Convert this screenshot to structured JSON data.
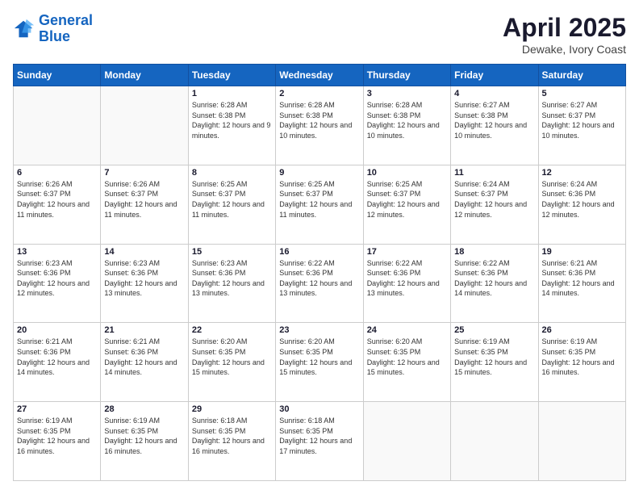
{
  "logo": {
    "line1": "General",
    "line2": "Blue"
  },
  "title": "April 2025",
  "subtitle": "Dewake, Ivory Coast",
  "days_header": [
    "Sunday",
    "Monday",
    "Tuesday",
    "Wednesday",
    "Thursday",
    "Friday",
    "Saturday"
  ],
  "weeks": [
    [
      {
        "day": "",
        "info": ""
      },
      {
        "day": "",
        "info": ""
      },
      {
        "day": "1",
        "info": "Sunrise: 6:28 AM\nSunset: 6:38 PM\nDaylight: 12 hours and 9 minutes."
      },
      {
        "day": "2",
        "info": "Sunrise: 6:28 AM\nSunset: 6:38 PM\nDaylight: 12 hours and 10 minutes."
      },
      {
        "day": "3",
        "info": "Sunrise: 6:28 AM\nSunset: 6:38 PM\nDaylight: 12 hours and 10 minutes."
      },
      {
        "day": "4",
        "info": "Sunrise: 6:27 AM\nSunset: 6:38 PM\nDaylight: 12 hours and 10 minutes."
      },
      {
        "day": "5",
        "info": "Sunrise: 6:27 AM\nSunset: 6:37 PM\nDaylight: 12 hours and 10 minutes."
      }
    ],
    [
      {
        "day": "6",
        "info": "Sunrise: 6:26 AM\nSunset: 6:37 PM\nDaylight: 12 hours and 11 minutes."
      },
      {
        "day": "7",
        "info": "Sunrise: 6:26 AM\nSunset: 6:37 PM\nDaylight: 12 hours and 11 minutes."
      },
      {
        "day": "8",
        "info": "Sunrise: 6:25 AM\nSunset: 6:37 PM\nDaylight: 12 hours and 11 minutes."
      },
      {
        "day": "9",
        "info": "Sunrise: 6:25 AM\nSunset: 6:37 PM\nDaylight: 12 hours and 11 minutes."
      },
      {
        "day": "10",
        "info": "Sunrise: 6:25 AM\nSunset: 6:37 PM\nDaylight: 12 hours and 12 minutes."
      },
      {
        "day": "11",
        "info": "Sunrise: 6:24 AM\nSunset: 6:37 PM\nDaylight: 12 hours and 12 minutes."
      },
      {
        "day": "12",
        "info": "Sunrise: 6:24 AM\nSunset: 6:36 PM\nDaylight: 12 hours and 12 minutes."
      }
    ],
    [
      {
        "day": "13",
        "info": "Sunrise: 6:23 AM\nSunset: 6:36 PM\nDaylight: 12 hours and 12 minutes."
      },
      {
        "day": "14",
        "info": "Sunrise: 6:23 AM\nSunset: 6:36 PM\nDaylight: 12 hours and 13 minutes."
      },
      {
        "day": "15",
        "info": "Sunrise: 6:23 AM\nSunset: 6:36 PM\nDaylight: 12 hours and 13 minutes."
      },
      {
        "day": "16",
        "info": "Sunrise: 6:22 AM\nSunset: 6:36 PM\nDaylight: 12 hours and 13 minutes."
      },
      {
        "day": "17",
        "info": "Sunrise: 6:22 AM\nSunset: 6:36 PM\nDaylight: 12 hours and 13 minutes."
      },
      {
        "day": "18",
        "info": "Sunrise: 6:22 AM\nSunset: 6:36 PM\nDaylight: 12 hours and 14 minutes."
      },
      {
        "day": "19",
        "info": "Sunrise: 6:21 AM\nSunset: 6:36 PM\nDaylight: 12 hours and 14 minutes."
      }
    ],
    [
      {
        "day": "20",
        "info": "Sunrise: 6:21 AM\nSunset: 6:36 PM\nDaylight: 12 hours and 14 minutes."
      },
      {
        "day": "21",
        "info": "Sunrise: 6:21 AM\nSunset: 6:36 PM\nDaylight: 12 hours and 14 minutes."
      },
      {
        "day": "22",
        "info": "Sunrise: 6:20 AM\nSunset: 6:35 PM\nDaylight: 12 hours and 15 minutes."
      },
      {
        "day": "23",
        "info": "Sunrise: 6:20 AM\nSunset: 6:35 PM\nDaylight: 12 hours and 15 minutes."
      },
      {
        "day": "24",
        "info": "Sunrise: 6:20 AM\nSunset: 6:35 PM\nDaylight: 12 hours and 15 minutes."
      },
      {
        "day": "25",
        "info": "Sunrise: 6:19 AM\nSunset: 6:35 PM\nDaylight: 12 hours and 15 minutes."
      },
      {
        "day": "26",
        "info": "Sunrise: 6:19 AM\nSunset: 6:35 PM\nDaylight: 12 hours and 16 minutes."
      }
    ],
    [
      {
        "day": "27",
        "info": "Sunrise: 6:19 AM\nSunset: 6:35 PM\nDaylight: 12 hours and 16 minutes."
      },
      {
        "day": "28",
        "info": "Sunrise: 6:19 AM\nSunset: 6:35 PM\nDaylight: 12 hours and 16 minutes."
      },
      {
        "day": "29",
        "info": "Sunrise: 6:18 AM\nSunset: 6:35 PM\nDaylight: 12 hours and 16 minutes."
      },
      {
        "day": "30",
        "info": "Sunrise: 6:18 AM\nSunset: 6:35 PM\nDaylight: 12 hours and 17 minutes."
      },
      {
        "day": "",
        "info": ""
      },
      {
        "day": "",
        "info": ""
      },
      {
        "day": "",
        "info": ""
      }
    ]
  ]
}
